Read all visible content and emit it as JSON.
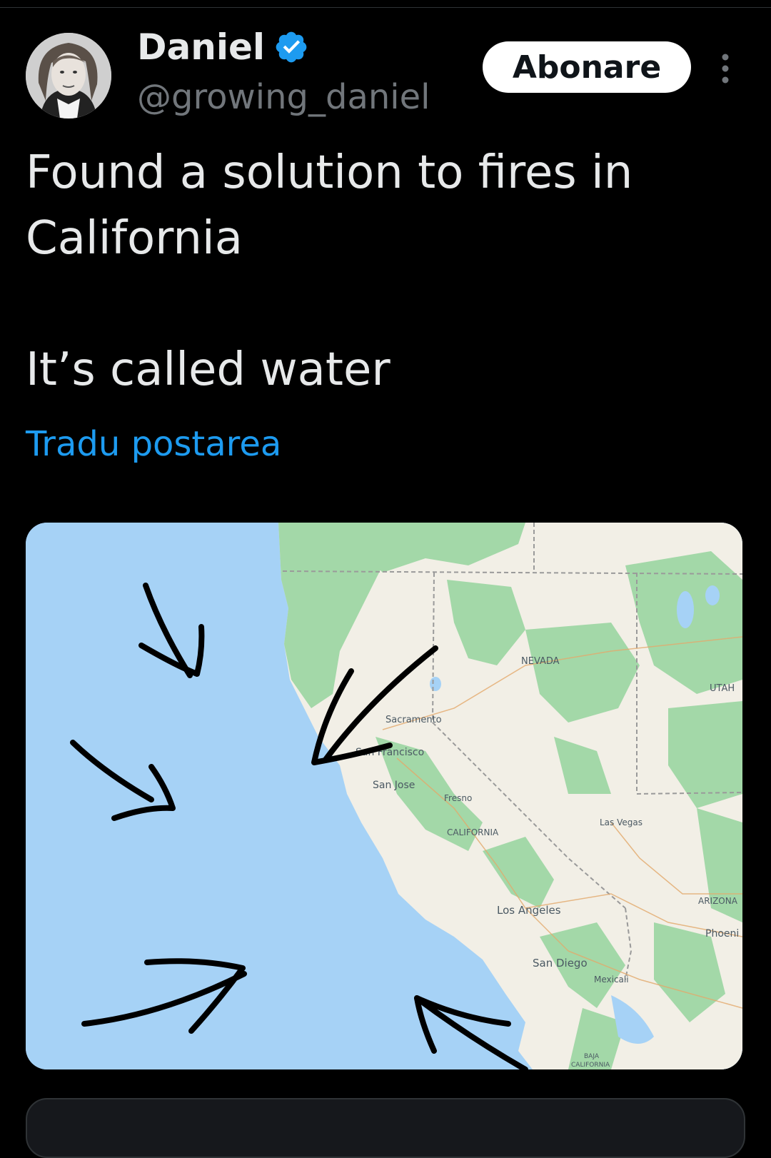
{
  "author": {
    "display_name": "Daniel",
    "handle": "@growing_daniel",
    "verified": true
  },
  "follow_button": {
    "label": "Abonare"
  },
  "tweet": {
    "lines": [
      "Found a solution to fires in",
      "California",
      "",
      "It’s called water"
    ]
  },
  "translate_link": "Tradu postarea",
  "map": {
    "labels": {
      "nevada": "NEVADA",
      "utah": "UTAH",
      "sacramento": "Sacramento",
      "san_francisco": "San Francisco",
      "san_jose": "San Jose",
      "fresno": "Fresno",
      "california": "CALIFORNIA",
      "las_vegas": "Las Vegas",
      "arizona": "ARIZONA",
      "phoenix": "Phoeni",
      "los_angeles": "Los Angeles",
      "san_diego": "San Diego",
      "mexicali": "Mexicali",
      "baja_1": "BAJA",
      "baja_2": "CALIFORNIA"
    }
  },
  "colors": {
    "background": "#000000",
    "text": "#e7e9ea",
    "muted": "#71767b",
    "link": "#1d9bf0",
    "ocean": "#a6d2f6",
    "land": "#f2efe6",
    "forest": "#9fd6a5"
  }
}
